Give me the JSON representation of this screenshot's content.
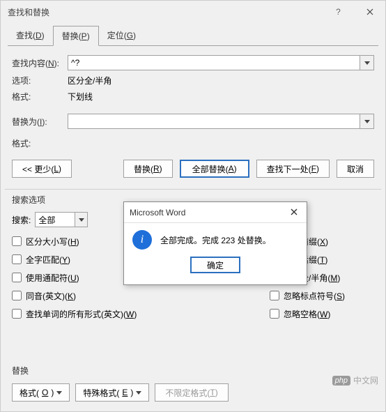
{
  "window": {
    "title": "查找和替换"
  },
  "tabs": {
    "find": {
      "label": "查找(",
      "hotkey": "D",
      "suffix": ")"
    },
    "replace": {
      "label": "替换(",
      "hotkey": "P",
      "suffix": ")"
    },
    "goto": {
      "label": "定位(",
      "hotkey": "G",
      "suffix": ")"
    }
  },
  "find": {
    "label": "查找内容(",
    "hotkey": "N",
    "suffix": "):",
    "value": "^?"
  },
  "option_line": {
    "label": "选项:",
    "value": "区分全/半角"
  },
  "format_line": {
    "label": "格式:",
    "value": "下划线"
  },
  "replace": {
    "label": "替换为(",
    "hotkey": "I",
    "suffix": "):",
    "value": ""
  },
  "format2_line": {
    "label": "格式:"
  },
  "buttons": {
    "less": {
      "pre": "<< 更少(",
      "hk": "L",
      "suf": ")"
    },
    "replace_one": {
      "pre": "替换(",
      "hk": "R",
      "suf": ")"
    },
    "replace_all": {
      "pre": "全部替换(",
      "hk": "A",
      "suf": ")"
    },
    "find_next": {
      "pre": "查找下一处(",
      "hk": "F",
      "suf": ")"
    },
    "cancel": "取消"
  },
  "search_options": {
    "header": "搜索选项",
    "search_label": "搜索:",
    "search_value": "全部",
    "left": [
      {
        "pre": "区分大小写(",
        "hk": "H",
        "suf": ")",
        "checked": false
      },
      {
        "pre": "全字匹配(",
        "hk": "Y",
        "suf": ")",
        "checked": false
      },
      {
        "pre": "使用通配符(",
        "hk": "U",
        "suf": ")",
        "checked": false
      },
      {
        "pre": "同音(英文)(",
        "hk": "K",
        "suf": ")",
        "checked": false
      },
      {
        "pre": "查找单词的所有形式(英文)(",
        "hk": "W",
        "suf": ")",
        "checked": false
      }
    ],
    "right": [
      {
        "pre": "区分前缀(",
        "hk": "X",
        "suf": ")",
        "checked": false
      },
      {
        "pre": "区分后缀(",
        "hk": "T",
        "suf": ")",
        "checked": false
      },
      {
        "pre": "区分全/半角(",
        "hk": "M",
        "suf": ")",
        "checked": true
      },
      {
        "pre": "忽略标点符号(",
        "hk": "S",
        "suf": ")",
        "checked": false
      },
      {
        "pre": "忽略空格(",
        "hk": "W",
        "suf": ")",
        "checked": false
      }
    ]
  },
  "bottom": {
    "header": "替换",
    "format_btn": {
      "pre": "格式(",
      "hk": "O",
      "suf": ")"
    },
    "special_btn": {
      "pre": "特殊格式(",
      "hk": "E",
      "suf": ")"
    },
    "noformat_btn": {
      "pre": "不限定格式(",
      "hk": "T",
      "suf": ")"
    }
  },
  "watermark": {
    "php": "php",
    "cn": "中文网"
  },
  "popup": {
    "title": "Microsoft Word",
    "message": "全部完成。完成 223 处替换。",
    "ok": "确定"
  }
}
